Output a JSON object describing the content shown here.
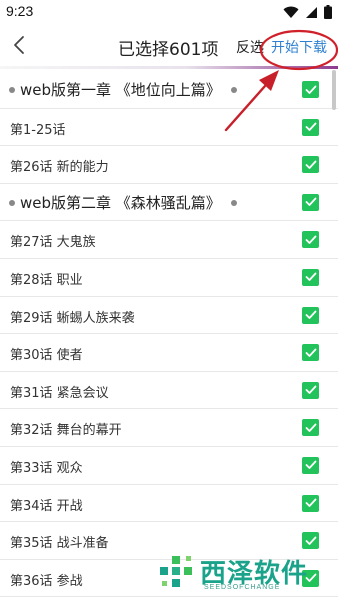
{
  "status_bar": {
    "time": "9:23",
    "icons": [
      "wifi-icon",
      "signal-icon",
      "battery-icon"
    ]
  },
  "header": {
    "back_icon": "chevron-left-icon",
    "title": "已选择601项",
    "invert_label": "反选",
    "start_download_label": "开始下载"
  },
  "list": [
    {
      "type": "chapter",
      "label": "web版第一章 《地位向上篇》",
      "checked": true
    },
    {
      "type": "episode",
      "label": "第1-25话",
      "checked": true
    },
    {
      "type": "episode",
      "label": "第26话 新的能力",
      "checked": true
    },
    {
      "type": "chapter",
      "label": "web版第二章 《森林骚乱篇》",
      "checked": true
    },
    {
      "type": "episode",
      "label": "第27话 大鬼族",
      "checked": true
    },
    {
      "type": "episode",
      "label": "第28话 职业",
      "checked": true
    },
    {
      "type": "episode",
      "label": "第29话 蜥蜴人族来袭",
      "checked": true
    },
    {
      "type": "episode",
      "label": "第30话 使者",
      "checked": true
    },
    {
      "type": "episode",
      "label": "第31话 紧急会议",
      "checked": true
    },
    {
      "type": "episode",
      "label": "第32话 舞台的幕开",
      "checked": true
    },
    {
      "type": "episode",
      "label": "第33话 观众",
      "checked": true
    },
    {
      "type": "episode",
      "label": "第34话 开战",
      "checked": true
    },
    {
      "type": "episode",
      "label": "第35话 战斗准备",
      "checked": true
    },
    {
      "type": "episode",
      "label": "第36话 参战",
      "checked": true
    }
  ],
  "watermark": {
    "name": "西泽软件",
    "sub": "SEEDSOFCHANGE"
  },
  "colors": {
    "accent_blue": "#2f80d1",
    "checkbox_green": "#23c35b",
    "annotation_red": "#d0202a",
    "watermark_teal": "#1aa38a"
  }
}
